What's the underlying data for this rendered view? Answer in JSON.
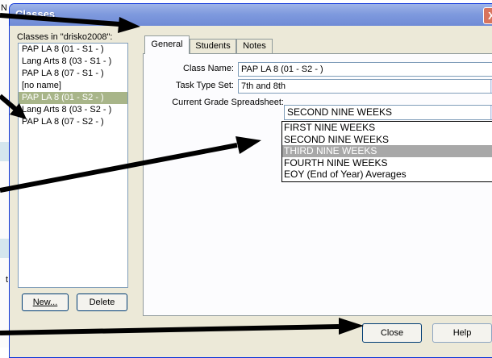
{
  "background": {
    "letter_top": "N",
    "letter_bottom": "t"
  },
  "window": {
    "title": "Classes",
    "close_glyph": "X"
  },
  "class_list": {
    "caption": "Classes in \"drisko2008\":",
    "items": [
      "PAP LA 8 (01 - S1 - )",
      "Lang Arts 8 (03 - S1 - )",
      "PAP LA 8 (07 - S1 - )",
      "[no name]",
      "PAP LA 8 (01 - S2 - )",
      "Lang Arts 8 (03 - S2 - )",
      "PAP LA 8 (07 - S2 - )"
    ],
    "selected_index": 4
  },
  "buttons": {
    "new": "New...",
    "delete": "Delete",
    "close": "Close",
    "help": "Help"
  },
  "tabs": [
    "General",
    "Students",
    "Notes"
  ],
  "general": {
    "class_name_label": "Class Name:",
    "class_name_value": "PAP LA 8 (01 - S2 - )",
    "task_type_label": "Task Type Set:",
    "task_type_value": "7th and 8th",
    "spreadsheet_label": "Current Grade Spreadsheet:",
    "spreadsheet_value": "SECOND NINE WEEKS",
    "spreadsheet_options": [
      "FIRST NINE WEEKS",
      "SECOND NINE WEEKS",
      "THIRD NINE WEEKS",
      "FOURTH NINE WEEKS",
      "EOY (End of Year) Averages"
    ],
    "highlighted_option_index": 2
  },
  "colors": {
    "selection": "#a8b589",
    "dropdown_highlight": "#a8a8a8",
    "titlebar": "#7f9ade"
  }
}
